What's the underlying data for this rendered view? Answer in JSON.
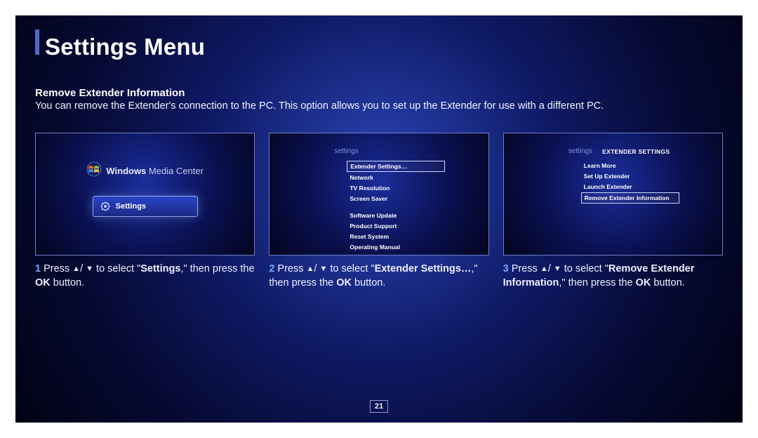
{
  "header": {
    "title": "Settings Menu"
  },
  "section": {
    "heading": "Remove Extender Information",
    "description": "You can remove the Extender's connection to the PC. This option allows you to set up the Extender for use with a different PC."
  },
  "panel1": {
    "logo_text_bold": "Windows",
    "logo_text_light": " Media Center",
    "button_label": "Settings"
  },
  "panel2": {
    "crumb": "settings",
    "items": [
      "Extender Settings…",
      "Network",
      "TV Resolution",
      "Screen Saver"
    ],
    "items2": [
      "Software Update",
      "Product Support",
      "Reset System",
      "Operating Manual"
    ],
    "selected_index": 0
  },
  "panel3": {
    "crumb": "settings",
    "title": "EXTENDER SETTINGS",
    "items": [
      "Learn More",
      "Set Up Extender",
      "Launch Extender",
      "Remove Extender Information"
    ],
    "selected_index": 3
  },
  "captions": {
    "c1": {
      "num": "1",
      "pre": "Press ",
      "mid": " to select \"",
      "bold1": "Settings",
      "tail": ",\" then press the ",
      "bold2": "OK",
      "end": " button."
    },
    "c2": {
      "num": "2",
      "pre": "Press ",
      "mid": " to select \"",
      "bold1": "Extender Settings…",
      "tail": ",\" then press the ",
      "bold2": "OK",
      "end": " button."
    },
    "c3": {
      "num": "3",
      "pre": "Press ",
      "mid": " to select \"",
      "bold1": "Remove Extender Information",
      "tail": ",\" then press the ",
      "bold2": "OK",
      "end": " button."
    }
  },
  "glyphs": {
    "up": "▲",
    "down": "▼",
    "slash": "/"
  },
  "page_number": "21"
}
